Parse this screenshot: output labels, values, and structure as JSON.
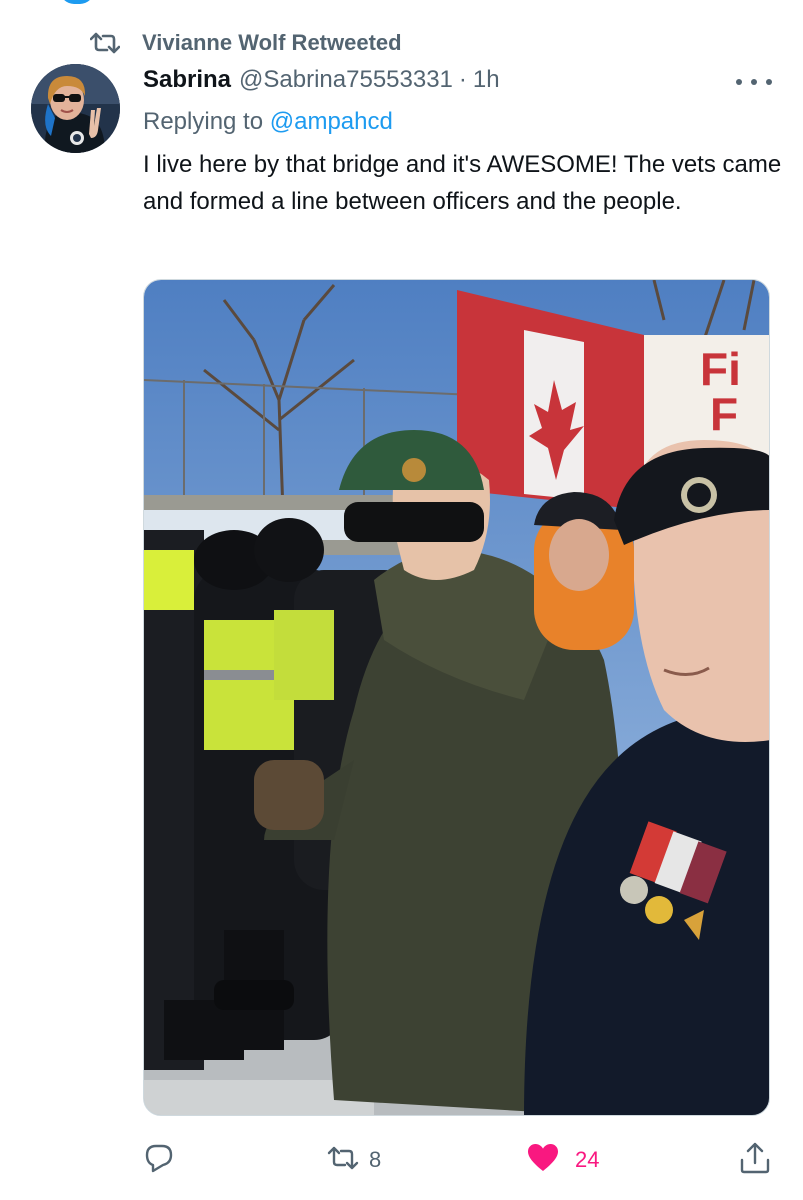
{
  "retweet_context": {
    "label": "Vivianne Wolf Retweeted",
    "icon": "retweet-icon"
  },
  "tweet": {
    "display_name": "Sabrina",
    "handle": "@Sabrina75553331",
    "separator": "·",
    "time": "1h",
    "reply_prefix": "Replying to",
    "reply_mention": "@ampahcd",
    "text": "I live here by that bridge and it's AWESOME! The vets came and formed a line between officers and the people.",
    "media": {
      "banner_text_line1": "Fi",
      "banner_text_line2": "F"
    }
  },
  "actions": {
    "reply": {
      "icon": "reply-icon"
    },
    "retweet": {
      "icon": "retweet-icon",
      "count": "8"
    },
    "like": {
      "icon": "heart-icon",
      "count": "24",
      "color": "#f91880"
    },
    "share": {
      "icon": "share-icon"
    }
  },
  "colors": {
    "text": "#0f1419",
    "secondary": "#536471",
    "link": "#1d9bf0",
    "like": "#f91880"
  }
}
